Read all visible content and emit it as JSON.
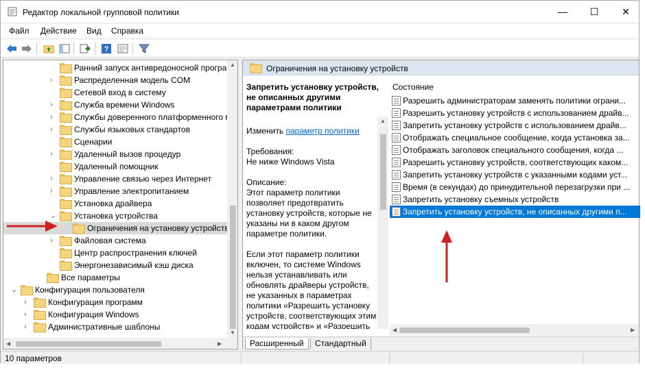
{
  "window": {
    "title": "Редактор локальной групповой политики",
    "minimize": "—",
    "maximize": "☐",
    "close": "✕"
  },
  "menu": [
    "Файл",
    "Действие",
    "Вид",
    "Справка"
  ],
  "toolbar": [
    "back-arrow-icon",
    "forward-arrow-icon",
    "up-folder-icon",
    "show-hide-tree-icon",
    "export-list-icon",
    "help-icon",
    "properties-icon",
    "filter-icon"
  ],
  "tree": {
    "items": [
      {
        "label": "Ранний запуск антивредоносной програ",
        "arrow": ""
      },
      {
        "label": "Распределенная модель COM",
        "arrow": "›"
      },
      {
        "label": "Сетевой вход в систему",
        "arrow": ""
      },
      {
        "label": "Служба времени Windows",
        "arrow": "›"
      },
      {
        "label": "Службы доверенного платформенного м",
        "arrow": "›"
      },
      {
        "label": "Службы языковых стандартов",
        "arrow": "›"
      },
      {
        "label": "Сценарии",
        "arrow": ""
      },
      {
        "label": "Удаленный вызов процедур",
        "arrow": "›"
      },
      {
        "label": "Удаленный помощник",
        "arrow": ""
      },
      {
        "label": "Управление связью через Интернет",
        "arrow": "›"
      },
      {
        "label": "Управление электропитанием",
        "arrow": "›"
      },
      {
        "label": "Установка драйвера",
        "arrow": ""
      },
      {
        "label": "Установка устройства",
        "arrow": "⌄"
      },
      {
        "label": "Ограничения на установку устройств",
        "arrow": ""
      },
      {
        "label": "Файловая система",
        "arrow": "›"
      },
      {
        "label": "Центр распространения ключей",
        "arrow": ""
      },
      {
        "label": "Энергонезависимый кэш диска",
        "arrow": ""
      },
      {
        "label": "Все параметры",
        "arrow": ""
      },
      {
        "label": "Конфигурация пользователя",
        "arrow": "⌄"
      },
      {
        "label": "Конфигурация программ",
        "arrow": "›"
      },
      {
        "label": "Конфигурация Windows",
        "arrow": "›"
      },
      {
        "label": "Административные шаблоны",
        "arrow": "›"
      }
    ]
  },
  "right": {
    "header": "Ограничения на установку устройств",
    "desc_title": "Запретить установку устройств, не описанных другими параметрами политики",
    "edit_prefix": "Изменить",
    "edit_link": "параметр политики",
    "req_label": "Требования:",
    "req_value": "Не ниже Windows Vista",
    "desc_label": "Описание:",
    "desc_p1": "Этот параметр политики позволяет предотвратить установку устройств, которые не указаны ни в каком другом параметре политики.",
    "desc_p2": "Если этот параметр политики включен, то системе Windows нельзя устанавливать или обновлять драйверы устройств, не указанных в параметрах политики «Разрешить установку устройств, соответствующих этим кодам устройств» и «Разрешить установку",
    "column_header": "Состояние",
    "policies": [
      "Разрешить администраторам заменять политики ограни...",
      "Разрешить установку устройств с использованием драйв...",
      "Запретить установку устройств с использованием драйв...",
      "Отображать специальное сообщение, когда установка за...",
      "Отображать заголовок специального сообщения, когда ...",
      "Разрешить установку устройств, соответствующих каком...",
      "Запретить установку устройств с указанными кодами уст...",
      "Время (в секундах) до принудительной перезагрузки при ...",
      "Запретить установку съемных устройств",
      "Запретить установку устройств, не описанных другими п..."
    ],
    "tab_extended": "Расширенный",
    "tab_standard": "Стандартный"
  },
  "status": "10 параметров",
  "colors": {
    "selection": "#0078d7",
    "annotation_arrow": "#cc1f1f",
    "header_bg": "#dbe6f2"
  }
}
